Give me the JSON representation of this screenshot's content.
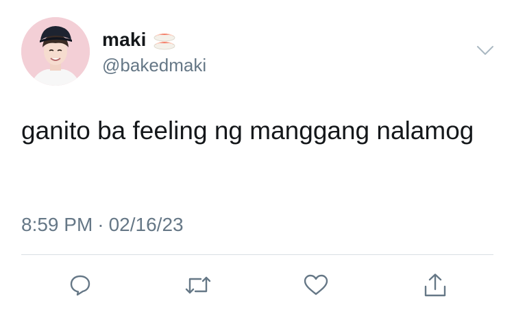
{
  "tweet": {
    "display_name": "maki",
    "name_emoji": "sushi-icon",
    "handle": "@bakedmaki",
    "text": "ganito ba feeling ng manggang nalamog",
    "time": "8:59 PM",
    "separator": "·",
    "date": "02/16/23"
  },
  "actions": [
    {
      "name": "reply",
      "icon": "speech-bubble-icon"
    },
    {
      "name": "retweet",
      "icon": "retweet-arrows-icon"
    },
    {
      "name": "like",
      "icon": "heart-icon"
    },
    {
      "name": "share",
      "icon": "share-upload-icon"
    }
  ],
  "colors": {
    "text": "#14171a",
    "secondary": "#657786",
    "divider": "#d9dee3",
    "icon": "#657786",
    "avatar_bg": "#f3cfd6"
  }
}
